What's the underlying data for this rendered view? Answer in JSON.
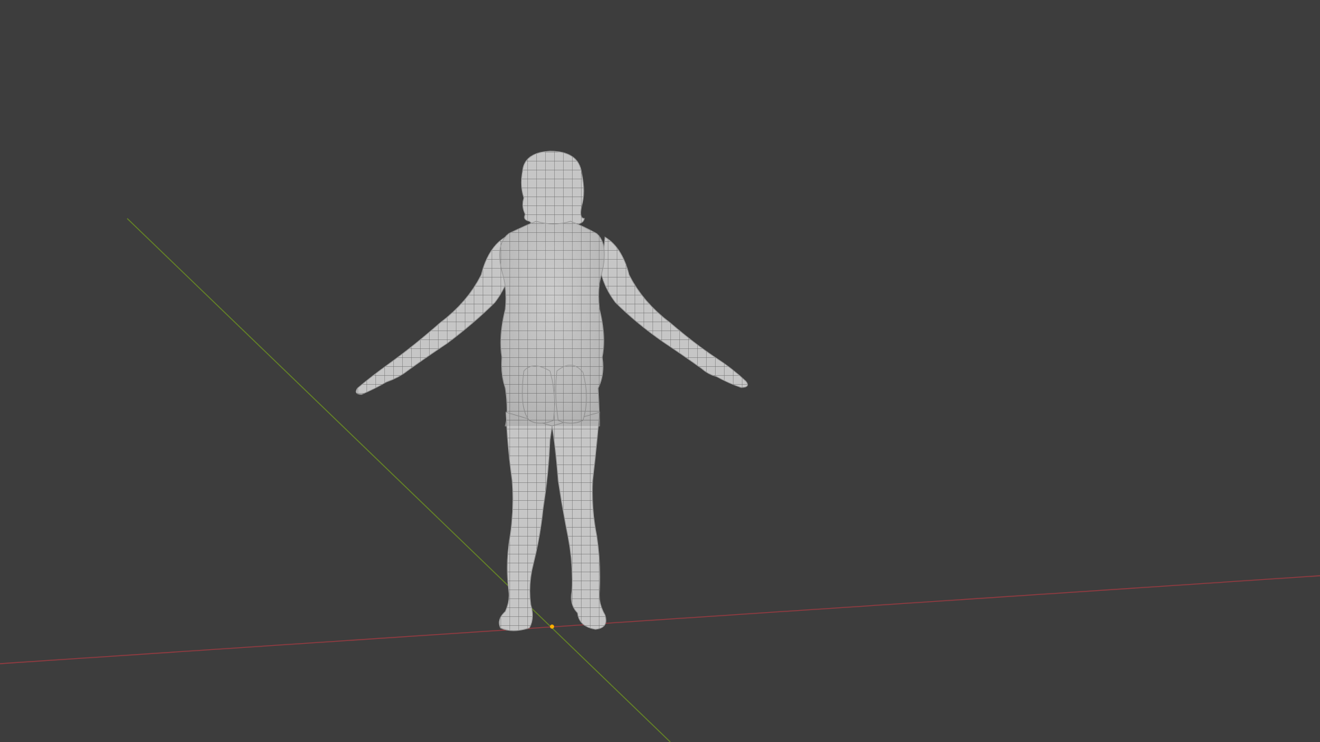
{
  "viewport": {
    "background_color": "#3d3d3d",
    "mesh_color": "#c9c9c9",
    "wire_color": "#6b6b6b",
    "x_axis_color": "#9e3b42",
    "y_axis_color": "#6b8e23",
    "origin_color": "#ffb000",
    "object": "humanoid-base-mesh",
    "view": "back"
  }
}
